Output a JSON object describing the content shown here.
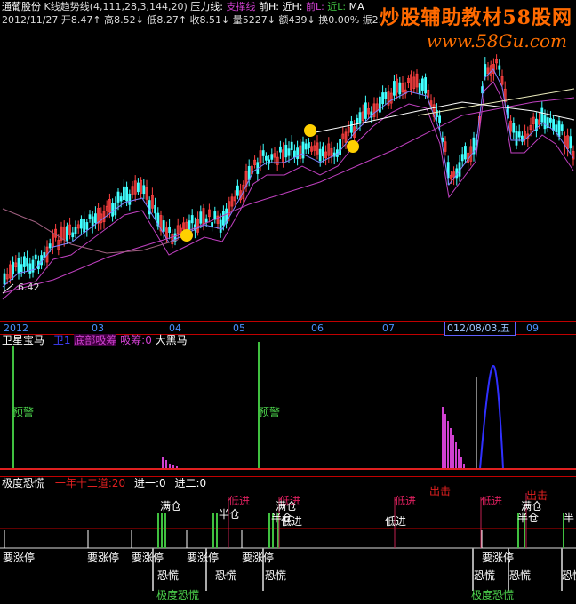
{
  "header": {
    "stock_name": "通葡股份",
    "indicator1": "K线趋势线(4,111,28,3,144,20)",
    "pressure": "压力线:",
    "support": "支撑线",
    "front_high": "前H:",
    "near_h": "近H:",
    "front_l": "前L:",
    "near_l": "近L:",
    "ma": "MA",
    "row2_date": "2012/11/27",
    "row2_open": "开8.47↑",
    "row2_high": "高8.52↓",
    "row2_low": "低8.27↑",
    "row2_close": "收8.51↓",
    "row2_vol": "量5227↓",
    "row2_amt": "额439↓",
    "row2_turn": "换0.00%",
    "row2_amp": "振2."
  },
  "watermark": {
    "line1": "炒股辅助教材58股网",
    "line2": "www.58Gu.com"
  },
  "price_low_label": "6.42",
  "months": [
    "2012",
    "03",
    "04",
    "05",
    "06",
    "07",
    "09"
  ],
  "cursor_date": "012/08/03,五",
  "panel2": {
    "title": "卫星宝马",
    "s1": "卫1",
    "s2": "底部吸筹",
    "s3": "吸筹:0",
    "s4": "大黑马",
    "labels": [
      {
        "text": "预警",
        "color": "#4cd44c"
      },
      {
        "text": "预警",
        "color": "#4cd44c"
      }
    ]
  },
  "panel3": {
    "title": "极度恐慌",
    "s1": "一年十二道:20",
    "s2": "进一:0",
    "s3": "进二:0",
    "labels": [
      {
        "text": "满仓",
        "color": "#ffffff"
      },
      {
        "text": "低进",
        "color": "#e02060"
      },
      {
        "text": "半仓",
        "color": "#ffffff"
      },
      {
        "text": "低进",
        "color": "#e02060"
      },
      {
        "text": "满仓",
        "color": "#ffffff"
      },
      {
        "text": "半仓",
        "color": "#ffffff"
      },
      {
        "text": "低进",
        "color": "#ffffff"
      },
      {
        "text": "低进",
        "color": "#ffffff"
      },
      {
        "text": "低进",
        "color": "#e02060"
      },
      {
        "text": "出击",
        "color": "#e02020"
      },
      {
        "text": "低进",
        "color": "#e02060"
      },
      {
        "text": "出击",
        "color": "#e02020"
      },
      {
        "text": "满仓",
        "color": "#ffffff"
      },
      {
        "text": "半仓",
        "color": "#ffffff"
      },
      {
        "text": "半",
        "color": "#ffffff"
      },
      {
        "text": "要涨停",
        "color": "#ffffff"
      },
      {
        "text": "要涨停",
        "color": "#ffffff"
      },
      {
        "text": "要涨停",
        "color": "#ffffff"
      },
      {
        "text": "要涨停",
        "color": "#ffffff"
      },
      {
        "text": "要涨停",
        "color": "#ffffff"
      },
      {
        "text": "要涨停",
        "color": "#ffffff"
      },
      {
        "text": "恐慌",
        "color": "#ffffff"
      },
      {
        "text": "恐慌",
        "color": "#ffffff"
      },
      {
        "text": "恐慌",
        "color": "#ffffff"
      },
      {
        "text": "恐慌",
        "color": "#ffffff"
      },
      {
        "text": "恐慌",
        "color": "#ffffff"
      },
      {
        "text": "恐慌",
        "color": "#ffffff"
      },
      {
        "text": "极度恐慌",
        "color": "#4cd44c"
      },
      {
        "text": "极度恐慌",
        "color": "#4cd44c"
      }
    ]
  },
  "colors": {
    "up_candle": "#ff4040",
    "down_candle": "#40ffff",
    "ma_purple": "#c040c0",
    "ma_white": "#ffffff",
    "separator": "#c00000",
    "green": "#40c040",
    "magenta": "#d040d0",
    "blue": "#3030ff"
  }
}
